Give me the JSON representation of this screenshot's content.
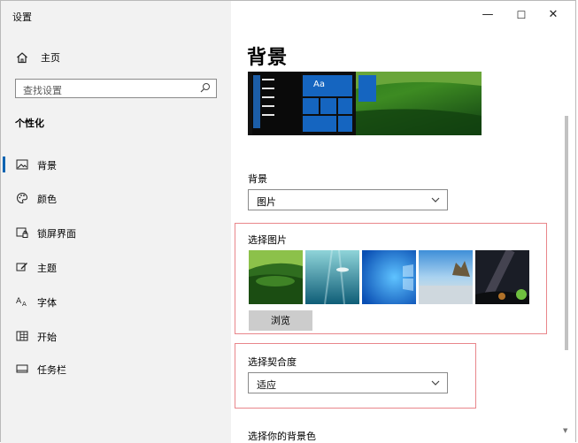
{
  "window": {
    "title": "设置",
    "min_glyph": "—",
    "max_glyph": "☐",
    "close_glyph": "✕"
  },
  "sidebar": {
    "home_label": "主页",
    "search_placeholder": "查找设置",
    "section_title": "个性化",
    "items": [
      {
        "label": "背景",
        "icon": "picture-icon",
        "selected": true
      },
      {
        "label": "颜色",
        "icon": "palette-icon",
        "selected": false
      },
      {
        "label": "锁屏界面",
        "icon": "lock-screen-icon",
        "selected": false
      },
      {
        "label": "主题",
        "icon": "brush-icon",
        "selected": false
      },
      {
        "label": "字体",
        "icon": "font-icon",
        "selected": false
      },
      {
        "label": "开始",
        "icon": "start-icon",
        "selected": false
      },
      {
        "label": "任务栏",
        "icon": "taskbar-icon",
        "selected": false
      }
    ]
  },
  "main": {
    "title": "背景",
    "preview": {
      "tile_text": "Aa"
    },
    "background_label": "背景",
    "background_value": "图片",
    "choose_picture_label": "选择图片",
    "thumbnails": [
      "green-landscape",
      "underwater",
      "windows-blue",
      "beach-rocks",
      "night-sky"
    ],
    "browse_label": "浏览",
    "fit_label": "选择契合度",
    "fit_value": "适应",
    "bg_color_label": "选择你的背景色"
  },
  "colors": {
    "accent": "#0063b1",
    "highlight_border": "#e9868b"
  }
}
